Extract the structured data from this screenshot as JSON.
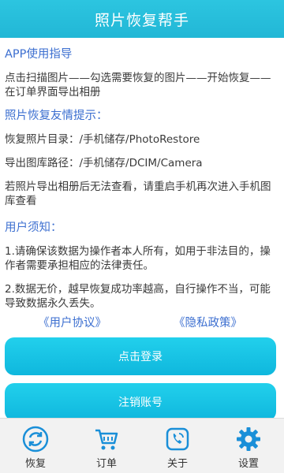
{
  "header": {
    "title": "照片恢复帮手"
  },
  "guide": {
    "title": "APP使用指导",
    "text": "点击扫描图片——勾选需要恢复的图片——开始恢复——在订单界面导出相册"
  },
  "tips": {
    "title": "照片恢复友情提示：",
    "restore_dir": "恢复照片目录：/手机储存/PhotoRestore",
    "export_path": "导出图库路径：/手机储存/DCIM/Camera",
    "note": "若照片导出相册后无法查看，请重启手机再次进入手机图库查看"
  },
  "notice": {
    "title": "用户须知：",
    "item1": "1.请确保该数据为操作者本人所有，如用于非法目的，操作者需要承担相应的法律责任。",
    "item2": "2.数据无价，越早恢复成功率越高，自行操作不当，可能导致数据永久丢失。"
  },
  "links": {
    "agreement": "《用户协议》",
    "privacy": "《隐私政策》"
  },
  "buttons": {
    "login": "点击登录",
    "cancel_account": "注销账号"
  },
  "tabbar": {
    "accent_color": "#1a8fd8",
    "items": [
      {
        "label": "恢复",
        "icon": "refresh-icon"
      },
      {
        "label": "订单",
        "icon": "cart-icon"
      },
      {
        "label": "关于",
        "icon": "phone-icon"
      },
      {
        "label": "设置",
        "icon": "gear-icon"
      }
    ]
  }
}
